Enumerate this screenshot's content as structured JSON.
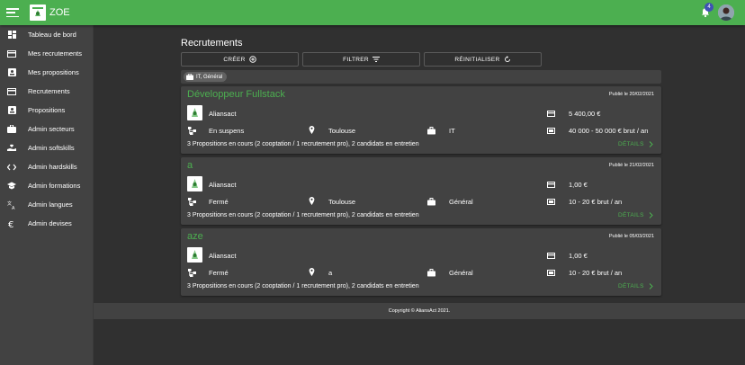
{
  "app": {
    "title": "ZOE",
    "notification_count": "4"
  },
  "sidebar": {
    "items": [
      {
        "label": "Tableau de bord",
        "icon": "dashboard-icon"
      },
      {
        "label": "Mes recrutements",
        "icon": "card-icon"
      },
      {
        "label": "Mes propositions",
        "icon": "badge-icon"
      },
      {
        "label": "Recrutements",
        "icon": "card-icon"
      },
      {
        "label": "Propositions",
        "icon": "badge-icon"
      },
      {
        "label": "Admin secteurs",
        "icon": "briefcase-icon"
      },
      {
        "label": "Admin softskills",
        "icon": "hand-heart-icon"
      },
      {
        "label": "Admin hardskills",
        "icon": "code-icon"
      },
      {
        "label": "Admin formations",
        "icon": "school-icon"
      },
      {
        "label": "Admin langues",
        "icon": "translate-icon"
      },
      {
        "label": "Admin devises",
        "icon": "euro-icon"
      }
    ]
  },
  "main": {
    "title": "Recrutements",
    "actions": {
      "create": "CRÉER",
      "filter": "FILTRER",
      "reset": "RÉINITIALISER"
    },
    "filter_chip": "IT, Général",
    "cards": [
      {
        "title": "Développeur Fullstack",
        "date": "Publié le 20/02/2021",
        "company": "Aliansact",
        "status": "En suspens",
        "location": "Toulouse",
        "sector": "IT",
        "fee": "5 400,00 €",
        "salary": "40 000 - 50 000 € brut / an",
        "summary": "3 Propositions en cours (2 cooptation / 1 recrutement pro), 2 candidats en entretien",
        "details": "DÉTAILS"
      },
      {
        "title": "a",
        "date": "Publié le 21/02/2021",
        "company": "Aliansact",
        "status": "Fermé",
        "location": "Toulouse",
        "sector": "Général",
        "fee": "1,00 €",
        "salary": "10 - 20 € brut / an",
        "summary": "3 Propositions en cours (2 cooptation / 1 recrutement pro), 2 candidats en entretien",
        "details": "DÉTAILS"
      },
      {
        "title": "aze",
        "date": "Publié le 05/03/2021",
        "company": "Aliansact",
        "status": "Fermé",
        "location": "a",
        "sector": "Général",
        "fee": "1,00 €",
        "salary": "10 - 20 € brut / an",
        "summary": "3 Propositions en cours (2 cooptation / 1 recrutement pro), 2 candidats en entretien",
        "details": "DÉTAILS"
      }
    ]
  },
  "footer": {
    "copyright": "Copyright © AliansAct 2021."
  },
  "colors": {
    "accent": "#4caf50",
    "background": "#303030",
    "surface": "#424242",
    "badge": "#3f51b5"
  }
}
